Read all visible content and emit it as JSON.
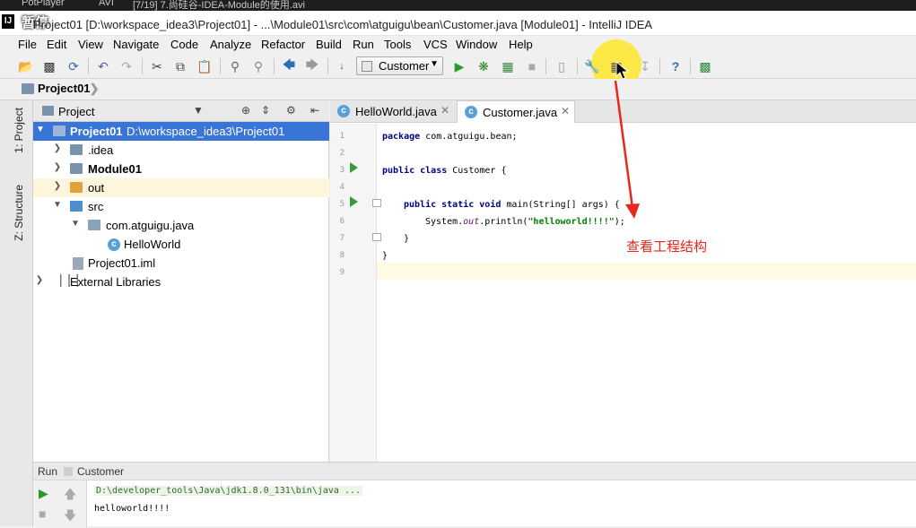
{
  "player": {
    "app": "PotPlayer",
    "format": "AVI",
    "file": "[7/19] 7.尚硅谷-IDEA-Module的使用.avi",
    "pause_overlay": "暂停"
  },
  "window": {
    "logo": "IJ",
    "title": "Project01 [D:\\workspace_idea3\\Project01] - ...\\Module01\\src\\com\\atguigu\\bean\\Customer.java [Module01] - IntelliJ IDEA"
  },
  "menu": [
    "File",
    "Edit",
    "View",
    "Navigate",
    "Code",
    "Analyze",
    "Refactor",
    "Build",
    "Run",
    "Tools",
    "VCS",
    "Window",
    "Help"
  ],
  "toolbar": {
    "run_config": "Customer",
    "icons": [
      "open-icon",
      "save-icon",
      "sync-icon",
      "undo-icon",
      "redo-icon",
      "cut-icon",
      "copy-icon",
      "paste-icon",
      "find-icon",
      "replace-icon",
      "back-icon",
      "forward-icon",
      "make-icon",
      "run-icon",
      "debug-icon",
      "coverage-icon",
      "stop-icon",
      "vcs-icon",
      "settings-icon",
      "project-structure-icon",
      "sdk-icon",
      "help-icon",
      "plugin-icon"
    ]
  },
  "navbar": {
    "crumb": "Project01"
  },
  "left_strip": {
    "tab_project": "1: Project",
    "tab_structure": "Z: Structure"
  },
  "project_panel": {
    "title": "Project",
    "tree": [
      {
        "label": "Project01",
        "extra": "D:\\workspace_idea3\\Project01",
        "icon": "module-folder",
        "expanded": true,
        "selected": true
      },
      {
        "label": ".idea",
        "icon": "folder",
        "expanded": false
      },
      {
        "label": "Module01",
        "icon": "module-folder",
        "expanded": false
      },
      {
        "label": "out",
        "icon": "excluded-folder",
        "expanded": false
      },
      {
        "label": "src",
        "icon": "source-folder",
        "expanded": true
      },
      {
        "label": "com.atguigu.java",
        "icon": "package",
        "expanded": true
      },
      {
        "label": "HelloWorld",
        "icon": "class"
      },
      {
        "label": "Project01.iml",
        "icon": "iml-file"
      },
      {
        "label": "External Libraries",
        "icon": "libraries",
        "expanded": false
      }
    ]
  },
  "editor": {
    "tabs": [
      {
        "label": "HelloWorld.java",
        "active": false
      },
      {
        "label": "Customer.java",
        "active": true
      }
    ],
    "line_numbers": [
      "1",
      "2",
      "3",
      "4",
      "5",
      "6",
      "7",
      "8",
      "9"
    ],
    "code": {
      "l1_kw": "package",
      "l1_rest": " com.atguigu.bean;",
      "l3_kw": "public class",
      "l3_rest": " Customer {",
      "l5_kw": "public static void",
      "l5_rest": " main(String[] args) {",
      "l6_pre": "System.",
      "l6_field": "out",
      "l6_mid": ".println(",
      "l6_str": "\"helloworld!!!!\"",
      "l6_end": ");",
      "l7": "}",
      "l8": "}"
    },
    "annotation": "查看工程结构"
  },
  "run_panel": {
    "tab": "Run",
    "config": "Customer",
    "command": "D:\\developer_tools\\Java\\jdk1.8.0_131\\bin\\java ...",
    "output": "helloworld!!!!"
  },
  "colors": {
    "selection": "#3875d7",
    "annotation": "#e8271e",
    "highlight": "#ffe628"
  }
}
